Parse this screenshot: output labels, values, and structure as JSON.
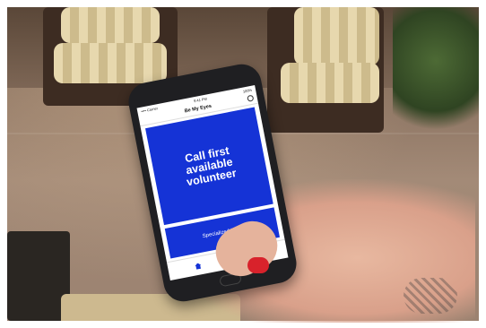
{
  "status_bar": {
    "carrier": "•••• Carrier",
    "time": "9:41 PM",
    "battery": "100%"
  },
  "nav": {
    "title": "Be My Eyes",
    "settings_icon": "gear-icon"
  },
  "main": {
    "call_button_label": "Call first\navailable\nvolunteer",
    "specialized_help_label": "Specialized Help"
  },
  "tabs": [
    {
      "icon": "home-icon",
      "active": true
    },
    {
      "icon": "heart-icon",
      "active": false
    }
  ],
  "colors": {
    "brand_blue": "#1533D6",
    "nail_red": "#D8222B"
  }
}
